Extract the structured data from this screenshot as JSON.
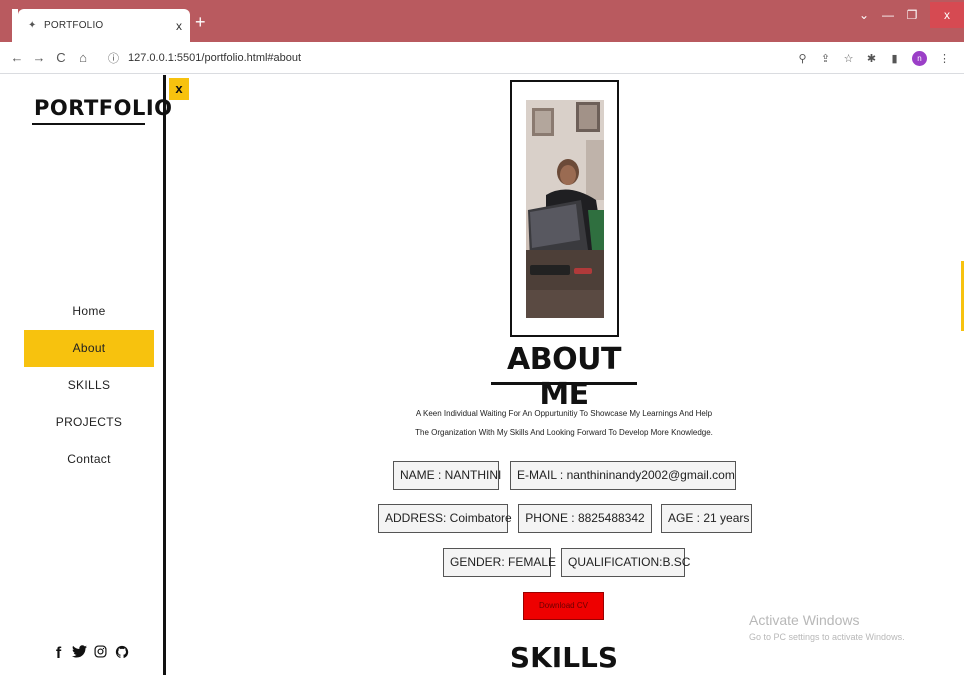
{
  "browser": {
    "tab_title": "PORTFOLIO",
    "tab_close": "x",
    "new_tab": "+",
    "url": "127.0.0.1:5501/portfolio.html#about",
    "win_minimize": "—",
    "win_restore": "❐",
    "win_close": "x",
    "win_chevron": "⌄",
    "profile_initial": "n"
  },
  "sidebar": {
    "logo": "PORTFOLIO",
    "close_label": "x",
    "nav": [
      {
        "label": "Home"
      },
      {
        "label": "About"
      },
      {
        "label": "SKILLS"
      },
      {
        "label": "PROJECTS"
      },
      {
        "label": "Contact"
      }
    ],
    "social_icons": [
      "facebook-icon",
      "twitter-icon",
      "instagram-icon",
      "github-icon"
    ]
  },
  "about": {
    "heading": "ABOUT ME",
    "description_line1": "A Keen Individual Waiting For An Oppurtunitiy To Showcase My Learnings And Help",
    "description_line2": "The Organization With My Skills And Looking Forward To Develop More Knowledge.",
    "name": "NAME : NANTHINI",
    "email": "E-MAIL : nanthininandy2002@gmail.com",
    "address": "ADDRESS: Coimbatore",
    "phone": "PHONE : 8825488342",
    "age": "AGE : 21 years",
    "gender": "GENDER: FEMALE",
    "qualification": "QUALIFICATION:B.SC",
    "download_cv": "Download CV"
  },
  "skills": {
    "heading": "SKILLS"
  },
  "watermark": {
    "title": "Activate Windows",
    "subtitle": "Go to PC settings to activate Windows."
  },
  "colors": {
    "accent": "#f7c20e",
    "tab_bar": "#b95a5f",
    "download_button": "#ee0000"
  }
}
